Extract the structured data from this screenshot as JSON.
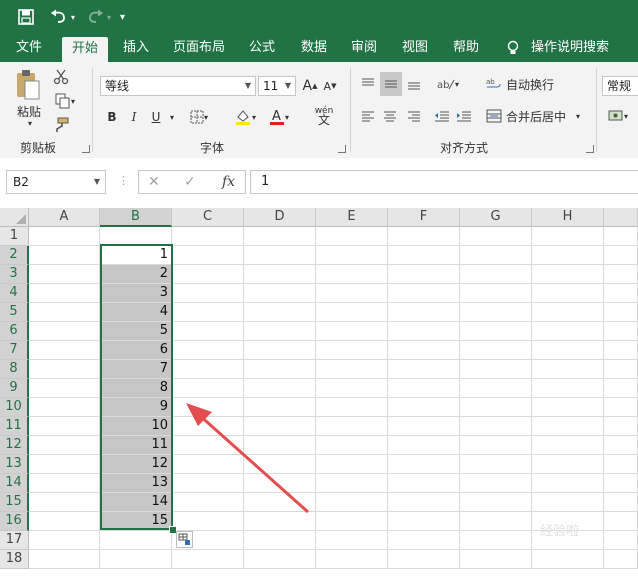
{
  "quick_access": {
    "more_label": "▾"
  },
  "tabs": [
    "文件",
    "开始",
    "插入",
    "页面布局",
    "公式",
    "数据",
    "审阅",
    "视图",
    "帮助",
    "操作说明搜索"
  ],
  "ribbon": {
    "clipboard": {
      "paste": "粘贴",
      "group": "剪贴板"
    },
    "font": {
      "family": "等线",
      "size": "11",
      "bold": "B",
      "italic": "I",
      "underline": "U",
      "grow": "A",
      "shrink": "A",
      "wen": "wén",
      "group": "字体"
    },
    "align": {
      "wrap": "自动换行",
      "merge": "合并后居中",
      "group": "对齐方式"
    },
    "number": {
      "format": "常规"
    }
  },
  "formula_bar": {
    "name_box": "B2",
    "fx": "fx",
    "value": "1"
  },
  "columns": [
    "A",
    "B",
    "C",
    "D",
    "E",
    "F",
    "G",
    "H"
  ],
  "rows": [
    "1",
    "2",
    "3",
    "4",
    "5",
    "6",
    "7",
    "8",
    "9",
    "10",
    "11",
    "12",
    "13",
    "14",
    "15",
    "16",
    "17",
    "18"
  ],
  "column_b_values": [
    "",
    "1",
    "2",
    "3",
    "4",
    "5",
    "6",
    "7",
    "8",
    "9",
    "10",
    "11",
    "12",
    "13",
    "14",
    "15",
    "",
    ""
  ],
  "watermark": "经验啦",
  "colors": {
    "accent": "#217346",
    "selection": "#c6c6c6",
    "arrow": "#e44d4d"
  }
}
